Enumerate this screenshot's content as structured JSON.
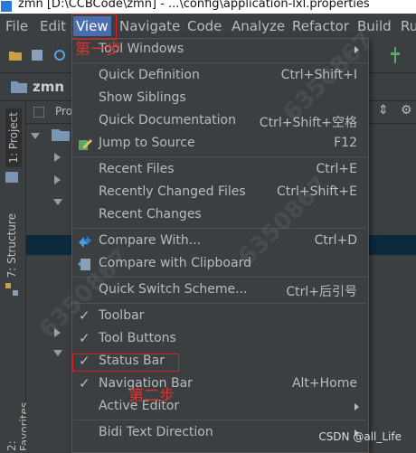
{
  "window": {
    "title": "zmn [D:\\CCBCode\\zmn] - ...\\config\\application-lxl.properties"
  },
  "menubar": {
    "items": [
      "File",
      "Edit",
      "View",
      "Navigate",
      "Code",
      "Analyze",
      "Refactor",
      "Build",
      "Ru"
    ],
    "active": "View"
  },
  "navbar": {
    "project": "zmn"
  },
  "project_panel": {
    "header": "Pro"
  },
  "side_tabs": {
    "project": "1: Project",
    "structure": "7: Structure",
    "favorites": "2: Favorites"
  },
  "view_menu": {
    "tool_windows": "Tool Windows",
    "quick_definition": {
      "label": "Quick Definition",
      "shortcut": "Ctrl+Shift+I"
    },
    "show_siblings": {
      "label": "Show Siblings"
    },
    "quick_documentation": {
      "label": "Quick Documentation",
      "shortcut": "Ctrl+Shift+空格"
    },
    "jump_to_source": {
      "label": "Jump to Source",
      "shortcut": "F12"
    },
    "recent_files": {
      "label": "Recent Files",
      "shortcut": "Ctrl+E"
    },
    "recently_changed_files": {
      "label": "Recently Changed Files",
      "shortcut": "Ctrl+Shift+E"
    },
    "recent_changes": {
      "label": "Recent Changes"
    },
    "compare_with": {
      "label": "Compare With...",
      "shortcut": "Ctrl+D"
    },
    "compare_with_clipboard": {
      "label": "Compare with Clipboard"
    },
    "quick_switch_scheme": {
      "label": "Quick Switch Scheme...",
      "shortcut": "Ctrl+后引号"
    },
    "toolbar": {
      "label": "Toolbar"
    },
    "tool_buttons": {
      "label": "Tool Buttons"
    },
    "status_bar": {
      "label": "Status Bar"
    },
    "navigation_bar": {
      "label": "Navigation Bar",
      "shortcut": "Alt+Home"
    },
    "active_editor": {
      "label": "Active Editor"
    },
    "bidi_text_direction": {
      "label": "Bidi Text Direction"
    }
  },
  "annotations": {
    "step1": "第一步",
    "step2": "第二步"
  },
  "watermark": {
    "text": "6350867"
  },
  "credit": "CSDN @all_Life",
  "colors": {
    "menu_bg": "#3c3f41",
    "active_menu": "#4b6eaf",
    "annotation": "#e02020",
    "selection_row": "#0d293e"
  }
}
